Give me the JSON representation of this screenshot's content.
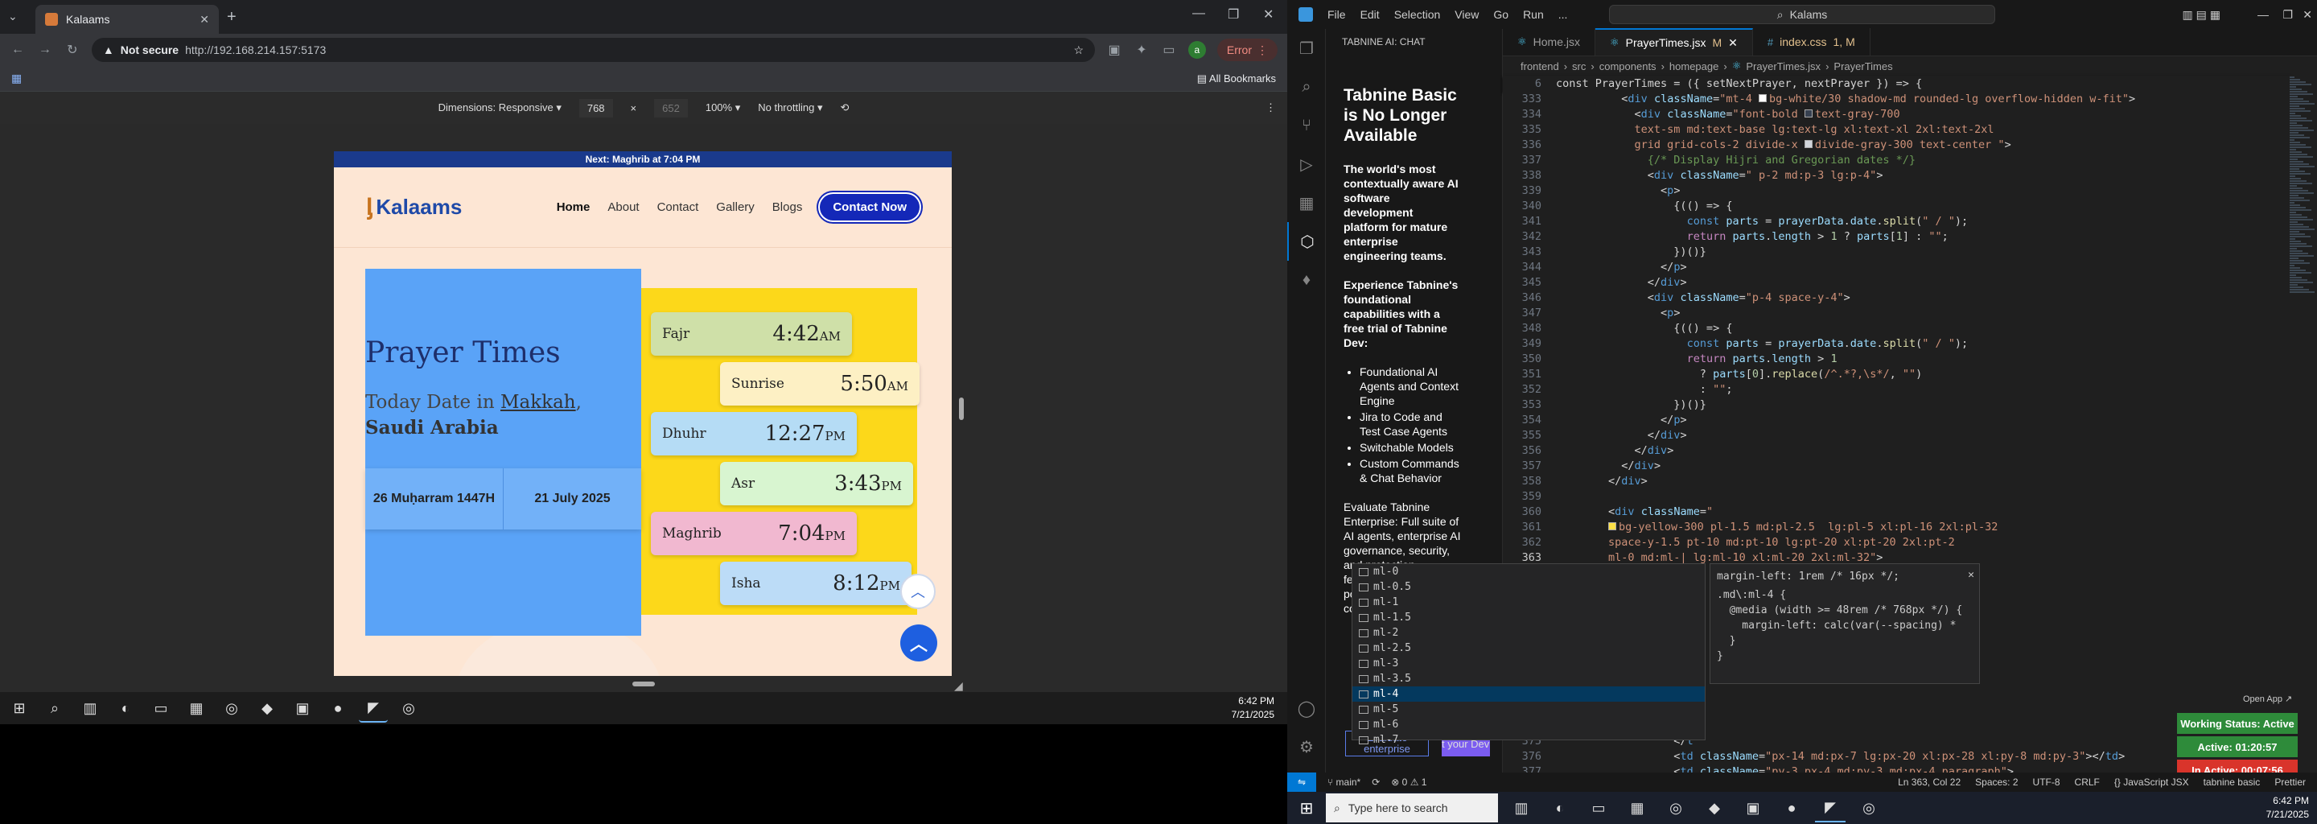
{
  "chrome": {
    "tab_title": "Kalaams",
    "new_tab_icon": "+",
    "not_secure": "Not secure",
    "url": "http://192.168.214.157:5173",
    "profile_letter": "a",
    "error_label": "Error",
    "all_bookmarks": "All Bookmarks",
    "dimensions_label": "Dimensions: Responsive",
    "width_value": "768",
    "height_value": "652",
    "zoom": "100%",
    "throttling": "No throttling"
  },
  "site": {
    "announcement": "Next: Maghrib at 7:04 PM",
    "logo_text": "Kalaams",
    "nav": [
      "Home",
      "About",
      "Contact",
      "Gallery",
      "Blogs"
    ],
    "cta": "Contact Now",
    "title": "Prayer Times",
    "date_prefix": "Today Date in",
    "city": "Makkah",
    "country": "Saudi Arabia",
    "hijri_date": "26 Muḥarram 1447H",
    "gregorian_date": "21 July 2025",
    "prayers": [
      {
        "name": "Fajr",
        "time": "4:42",
        "ampm": "AM",
        "color": "#cfe0a8"
      },
      {
        "name": "Sunrise",
        "time": "5:50",
        "ampm": "AM",
        "color": "#fdf0c4"
      },
      {
        "name": "Dhuhr",
        "time": "12:27",
        "ampm": "PM",
        "color": "#b5dcf5"
      },
      {
        "name": "Asr",
        "time": "3:43",
        "ampm": "PM",
        "color": "#d8f5d0"
      },
      {
        "name": "Maghrib",
        "time": "7:04",
        "ampm": "PM",
        "color": "#f1b8d0"
      },
      {
        "name": "Isha",
        "time": "8:12",
        "ampm": "PM",
        "color": "#bcdcf7"
      }
    ]
  },
  "taskbar_left": {
    "time": "6:42 PM",
    "date": "7/21/2025"
  },
  "vscode": {
    "menu": [
      "File",
      "Edit",
      "Selection",
      "View",
      "Go",
      "Run",
      "..."
    ],
    "search": "Kalams",
    "panel_title": "TABNINE AI: CHAT",
    "tn_heading": "Tabnine Basic is No Longer Available",
    "tn_p1": "The world's most contextually aware AI software development platform for mature enterprise engineering teams.",
    "tn_p2": "Experience Tabnine's foundational capabilities with a free trial of Tabnine Dev:",
    "tn_list": [
      "Foundational AI Agents and Context Engine",
      "Jira to Code and Test Case Agents",
      "Switchable Models",
      "Custom Commands & Chat Behavior"
    ],
    "tn_p3": "Evaluate Tabnine Enterprise: Full suite of AI agents, enterprise AI governance, security, and protection features, and the full power of our advanced context engine.",
    "tn_btn1": "Evaluate enterprise",
    "tn_btn2": "Start your Dev trial",
    "tabs": [
      {
        "label": "Home.jsx",
        "mod": ""
      },
      {
        "label": "PrayerTimes.jsx",
        "mod": "M"
      },
      {
        "label": "index.css",
        "mod": "1, M"
      }
    ],
    "breadcrumbs": [
      "frontend",
      "src",
      "components",
      "homepage",
      "PrayerTimes.jsx",
      "PrayerTimes"
    ],
    "sticky_num": "6",
    "sticky_code": "const PrayerTimes = ({ setNextPrayer, nextPrayer }) => {",
    "suggestions": [
      "ml-0",
      "ml-0.5",
      "ml-1",
      "ml-1.5",
      "ml-2",
      "ml-2.5",
      "ml-3",
      "ml-3.5",
      "ml-4",
      "ml-5",
      "ml-6",
      "ml-7"
    ],
    "suggest_detail": [
      "margin-left: 1rem /* 16px */;",
      ".md\\:ml-4 {",
      "  @media (width >= 48rem /* 768px */) {",
      "    margin-left: calc(var(--spacing) *",
      "  }",
      "}"
    ],
    "open_app": "Open App ↗",
    "badges": [
      {
        "label": "Working Status: Active",
        "color": "#2e8b3a"
      },
      {
        "label": "Active: 01:20:57",
        "color": "#2e8b3a"
      },
      {
        "label": "In Active: 00:07:56",
        "color": "#d9342b"
      }
    ],
    "status_left": [
      "main*",
      "⊗ 0 ⚠ 1"
    ],
    "status_right": [
      "Ln 363, Col 22",
      "Spaces: 2",
      "UTF-8",
      "CRLF",
      "{} JavaScript JSX",
      "tabnine basic",
      "Prettier"
    ]
  },
  "taskbar_right": {
    "search_placeholder": "Type here to search",
    "time": "6:42 PM",
    "date": "7/21/2025"
  }
}
